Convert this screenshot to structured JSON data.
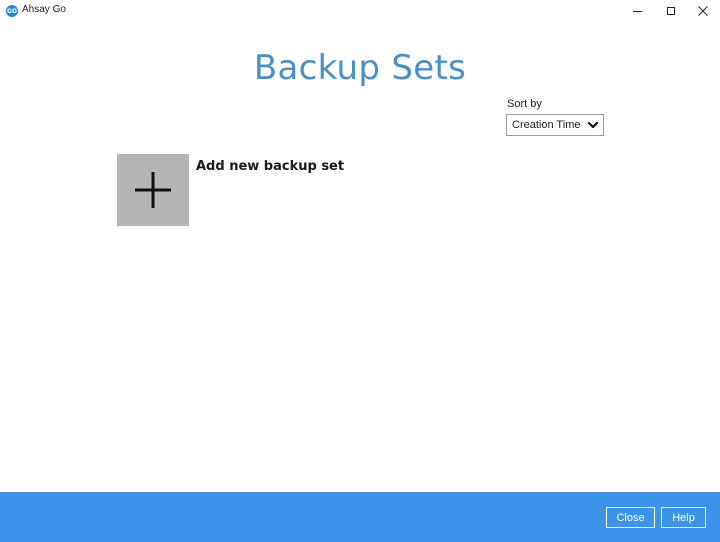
{
  "window": {
    "title": "Ahsay Go",
    "logo_text": "GO"
  },
  "page": {
    "title": "Backup Sets"
  },
  "sort": {
    "label": "Sort by",
    "selected": "Creation Time"
  },
  "add_backup_set": {
    "label": "Add new backup set"
  },
  "footer": {
    "close_label": "Close",
    "help_label": "Help"
  },
  "colors": {
    "title_blue": "#4a90c8",
    "footer_blue": "#3b94e8",
    "tile_gray": "#b5b5b5"
  },
  "icons": {
    "logo": "app-logo-icon",
    "minimize": "minimize-icon",
    "maximize": "maximize-icon",
    "close": "close-icon",
    "dropdown": "chevron-down-icon",
    "add": "plus-icon"
  }
}
